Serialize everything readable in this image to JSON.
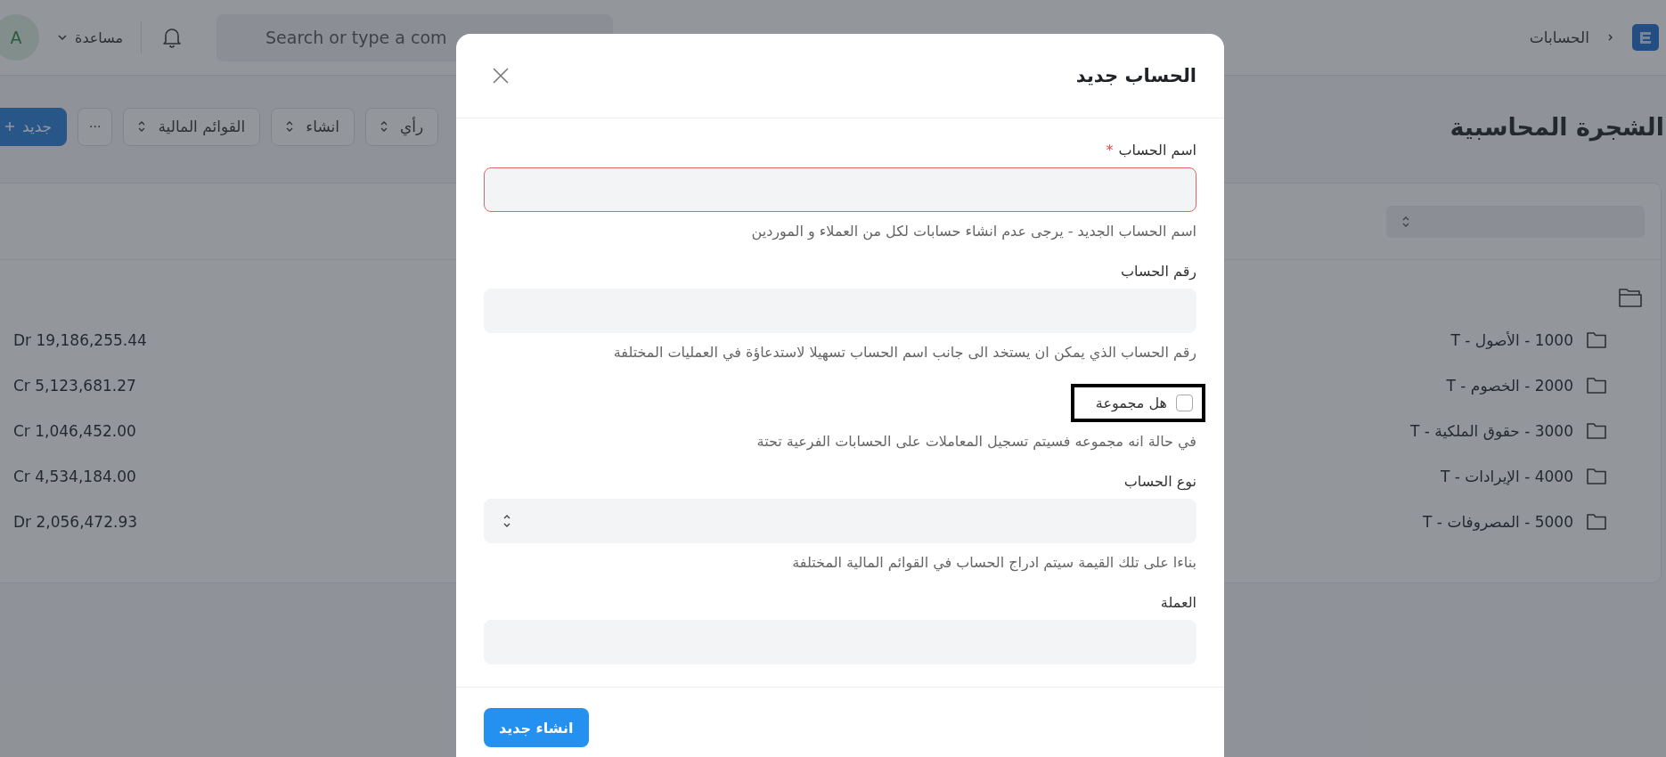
{
  "navbar": {
    "avatar": "A",
    "help": "مساعدة",
    "search": {
      "placeholder": "Search or type a com"
    },
    "breadcrumb": [
      "الحسابات"
    ]
  },
  "page": {
    "title": "الشجرة المحاسبية",
    "toolbar": [
      {
        "kind": "dropdown",
        "label": "رأي"
      },
      {
        "kind": "dropdown",
        "label": "انشاء"
      },
      {
        "kind": "dropdown",
        "label": "القوائم المالية"
      },
      {
        "kind": "more",
        "label": "···"
      },
      {
        "kind": "primary",
        "label": "جديد"
      }
    ]
  },
  "tree": {
    "expanded": true,
    "children": [
      {
        "label": "1000 - الأصول - T",
        "balance": "Dr 19,186,255.44",
        "expanded": false
      },
      {
        "label": "2000 - الخصوم - T",
        "balance": "Cr 5,123,681.27",
        "expanded": false
      },
      {
        "label": "3000 - حقوق الملكية - T",
        "balance": "Cr 1,046,452.00",
        "expanded": false
      },
      {
        "label": "4000 - الإيرادات - T",
        "balance": "Cr 4,534,184.00",
        "expanded": false
      },
      {
        "label": "5000 - المصروفات - T",
        "balance": "Dr 2,056,472.93",
        "expanded": false
      }
    ]
  },
  "modal": {
    "title": "الحساب جديد",
    "fields": [
      {
        "kind": "text",
        "label": "اسم الحساب",
        "required_mark": "*",
        "invalid": true,
        "description": "اسم الحساب الجديد - يرجى عدم انشاء حسابات لكل من العملاء و الموردين"
      },
      {
        "kind": "text",
        "label": "رقم الحساب",
        "invalid": false,
        "description": "رقم الحساب الذي يمكن ان يستخد الى جانب اسم الحساب تسهيلا لاستدعاؤة في العمليات المختلفة"
      },
      {
        "kind": "checkbox",
        "label": "هل مجموعة",
        "checked": false,
        "highlighted": true,
        "description": "في حالة انه مجموعه فسيتم تسجيل المعاملات على الحسابات الفرعية تحتة"
      },
      {
        "kind": "select",
        "label": "نوع الحساب",
        "invalid": false,
        "description": "بناءا على تلك القيمة سيتم ادراج الحساب في القوائم المالية المختلفة"
      },
      {
        "kind": "text",
        "label": "العملة",
        "invalid": false
      }
    ],
    "primary_button": "انشاء جديد"
  }
}
